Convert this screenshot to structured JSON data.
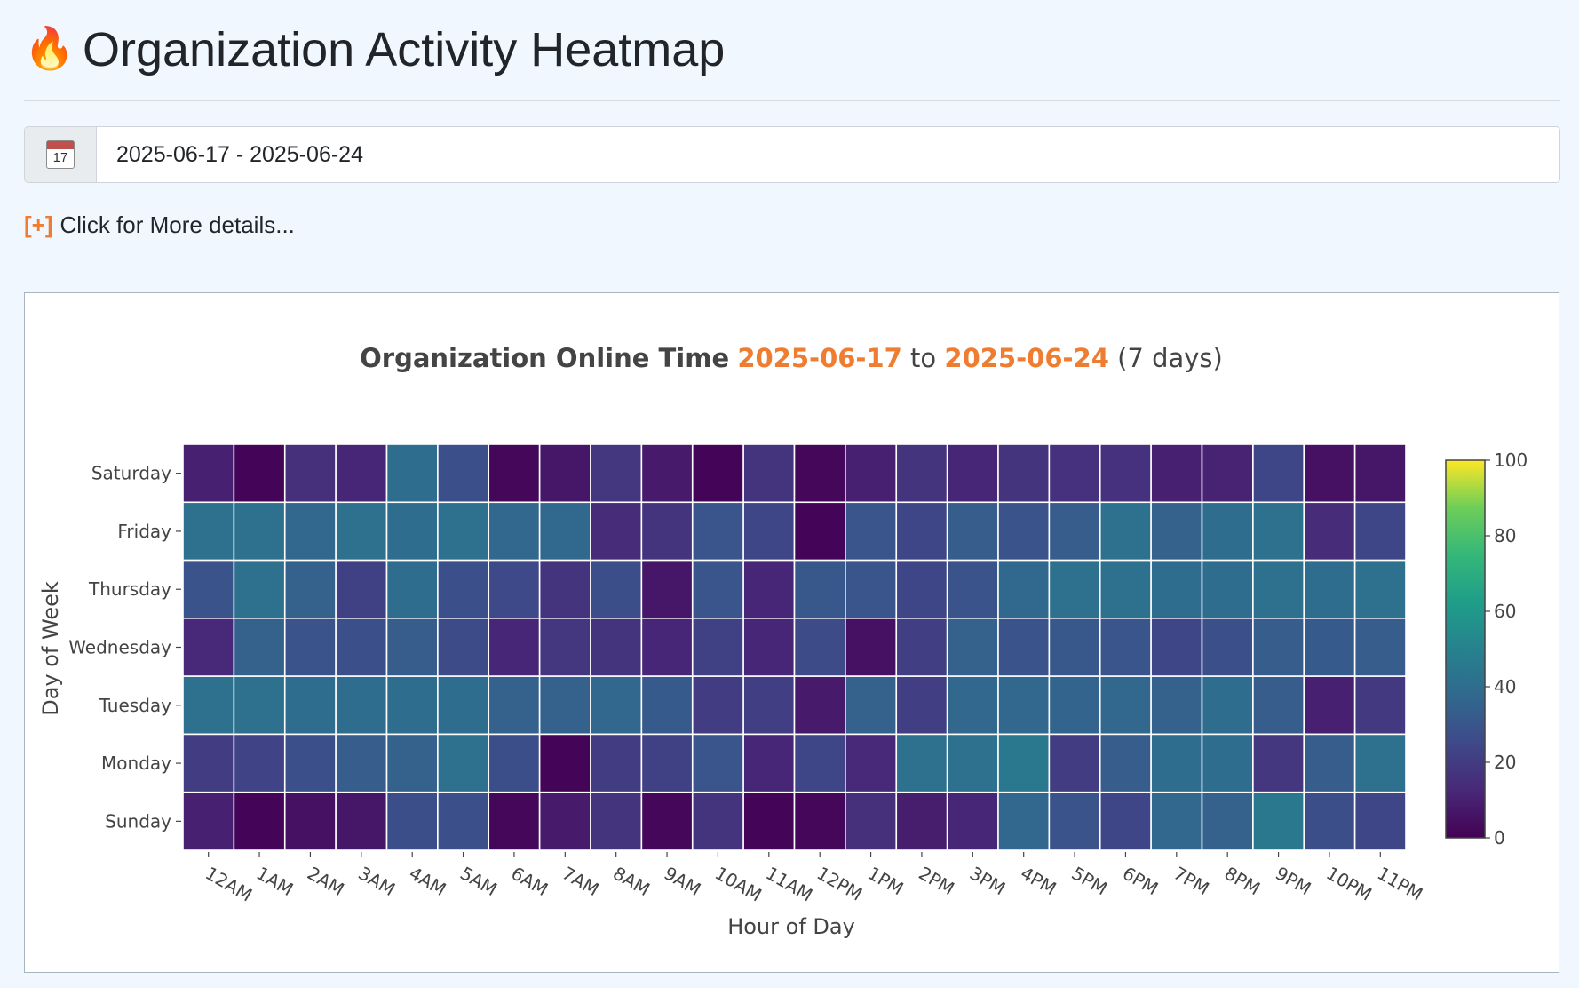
{
  "header": {
    "icon": "fire-icon",
    "icon_glyph": "🔥",
    "title": "Organization Activity Heatmap"
  },
  "date_picker": {
    "icon": "calendar-icon",
    "icon_day": "17",
    "value": "2025-06-17 - 2025-06-24"
  },
  "details_toggle": {
    "marker": "[+]",
    "label": "Click for More details..."
  },
  "chart_data": {
    "type": "heatmap",
    "title": {
      "prefix": "Organization Online Time",
      "start": "2025-06-17",
      "to": "to",
      "end": "2025-06-24",
      "suffix": "(7 days)"
    },
    "title_highlight_color": "#ef7d31",
    "xlabel": "Hour of Day",
    "ylabel": "Day of Week",
    "x": [
      "12AM",
      "1AM",
      "2AM",
      "3AM",
      "4AM",
      "5AM",
      "6AM",
      "7AM",
      "8AM",
      "9AM",
      "10AM",
      "11AM",
      "12PM",
      "1PM",
      "2PM",
      "3PM",
      "4PM",
      "5PM",
      "6PM",
      "7PM",
      "8PM",
      "9PM",
      "10PM",
      "11PM"
    ],
    "y": [
      "Saturday",
      "Friday",
      "Thursday",
      "Wednesday",
      "Tuesday",
      "Monday",
      "Sunday"
    ],
    "z": [
      [
        10,
        1,
        15,
        12,
        40,
        28,
        2,
        7,
        18,
        8,
        1,
        17,
        2,
        10,
        17,
        12,
        17,
        16,
        16,
        10,
        11,
        24,
        5,
        7
      ],
      [
        42,
        42,
        37,
        42,
        40,
        42,
        37,
        38,
        14,
        17,
        30,
        24,
        1,
        30,
        24,
        33,
        29,
        33,
        42,
        35,
        40,
        42,
        14,
        24
      ],
      [
        29,
        42,
        35,
        22,
        40,
        28,
        25,
        17,
        27,
        7,
        30,
        12,
        31,
        30,
        24,
        29,
        38,
        42,
        42,
        40,
        40,
        42,
        40,
        42
      ],
      [
        13,
        35,
        29,
        28,
        33,
        26,
        12,
        18,
        17,
        12,
        22,
        12,
        26,
        5,
        21,
        35,
        29,
        31,
        30,
        24,
        28,
        33,
        32,
        33
      ],
      [
        42,
        42,
        40,
        40,
        40,
        40,
        35,
        35,
        37,
        32,
        20,
        21,
        8,
        35,
        21,
        37,
        37,
        36,
        37,
        35,
        40,
        33,
        10,
        19
      ],
      [
        20,
        23,
        28,
        33,
        35,
        42,
        27,
        1,
        20,
        22,
        30,
        12,
        24,
        13,
        42,
        42,
        45,
        20,
        33,
        40,
        40,
        18,
        33,
        42
      ],
      [
        10,
        1,
        5,
        7,
        27,
        28,
        2,
        8,
        17,
        2,
        17,
        1,
        2,
        15,
        9,
        12,
        37,
        29,
        24,
        37,
        35,
        45,
        27,
        24
      ]
    ],
    "zmin": 0,
    "zmax": 100,
    "colorbar_ticks": [
      0,
      20,
      40,
      60,
      80,
      100
    ],
    "colorscale": "Viridis"
  }
}
